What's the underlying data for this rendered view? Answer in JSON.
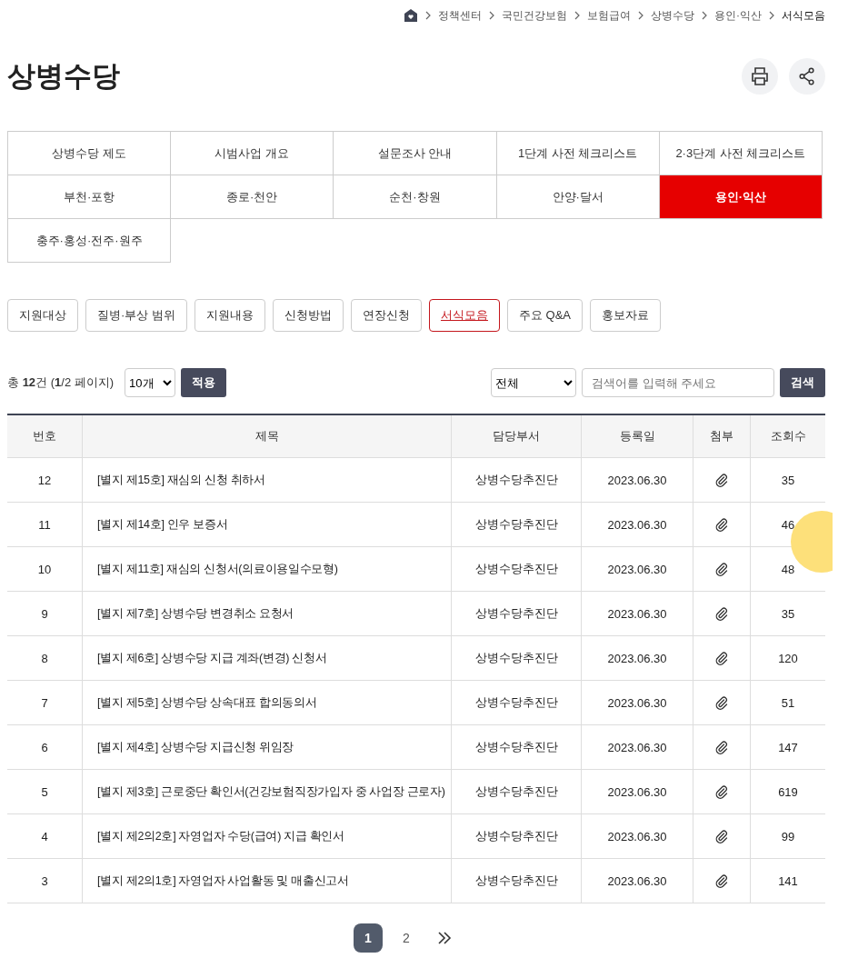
{
  "breadcrumb": [
    "정책센터",
    "국민건강보험",
    "보험급여",
    "상병수당",
    "용인·익산",
    "서식모음"
  ],
  "title": "상병수당",
  "region_tabs": [
    {
      "label": "상병수당 제도",
      "selected": false
    },
    {
      "label": "시범사업 개요",
      "selected": false
    },
    {
      "label": "설문조사 안내",
      "selected": false
    },
    {
      "label": "1단계 사전 체크리스트",
      "selected": false
    },
    {
      "label": "2·3단계 사전 체크리스트",
      "selected": false
    },
    {
      "label": "부천·포항",
      "selected": false
    },
    {
      "label": "종로·천안",
      "selected": false
    },
    {
      "label": "순천·창원",
      "selected": false
    },
    {
      "label": "안양·달서",
      "selected": false
    },
    {
      "label": "용인·익산",
      "selected": true
    },
    {
      "label": "충주·홍성·전주·원주",
      "selected": false
    }
  ],
  "sub_tabs": [
    {
      "label": "지원대상",
      "selected": false
    },
    {
      "label": "질병·부상 범위",
      "selected": false
    },
    {
      "label": "지원내용",
      "selected": false
    },
    {
      "label": "신청방법",
      "selected": false
    },
    {
      "label": "연장신청",
      "selected": false
    },
    {
      "label": "서식모음",
      "selected": true
    },
    {
      "label": "주요 Q&A",
      "selected": false
    },
    {
      "label": "홍보자료",
      "selected": false
    }
  ],
  "summary": "총 **12**건 (**1**/2 페이지)",
  "page_size": "10개",
  "apply_button": "적용",
  "search_scope": "전체",
  "search": {
    "placeholder": "검색어를 입력해 주세요"
  },
  "search_button": "검색",
  "table": {
    "columns": [
      "번호",
      "제목",
      "담당부서",
      "등록일",
      "첨부",
      "조회수"
    ],
    "rows": [
      {
        "no": "12",
        "title": "[별지 제15호] 재심의 신청 취하서",
        "dept": "상병수당추진단",
        "date": "2023.06.30",
        "views": "35"
      },
      {
        "no": "11",
        "title": "[별지 제14호] 인우 보증서",
        "dept": "상병수당추진단",
        "date": "2023.06.30",
        "views": "46"
      },
      {
        "no": "10",
        "title": "[별지 제11호] 재심의 신청서(의료이용일수모형)",
        "dept": "상병수당추진단",
        "date": "2023.06.30",
        "views": "48"
      },
      {
        "no": "9",
        "title": "[별지 제7호] 상병수당 변경취소 요청서",
        "dept": "상병수당추진단",
        "date": "2023.06.30",
        "views": "35"
      },
      {
        "no": "8",
        "title": "[별지 제6호] 상병수당 지급 계좌(변경) 신청서",
        "dept": "상병수당추진단",
        "date": "2023.06.30",
        "views": "120"
      },
      {
        "no": "7",
        "title": "[별지 제5호] 상병수당 상속대표 합의동의서",
        "dept": "상병수당추진단",
        "date": "2023.06.30",
        "views": "51"
      },
      {
        "no": "6",
        "title": "[별지 제4호] 상병수당 지급신청 위임장",
        "dept": "상병수당추진단",
        "date": "2023.06.30",
        "views": "147"
      },
      {
        "no": "5",
        "title": "[별지 제3호] 근로중단 확인서(건강보험직장가입자 중 사업장 근로자)",
        "dept": "상병수당추진단",
        "date": "2023.06.30",
        "views": "619"
      },
      {
        "no": "4",
        "title": "[별지 제2의2호] 자영업자 수당(급여) 지급 확인서",
        "dept": "상병수당추진단",
        "date": "2023.06.30",
        "views": "99"
      },
      {
        "no": "3",
        "title": "[별지 제2의1호] 자영업자 사업활동 및 매출신고서",
        "dept": "상병수당추진단",
        "date": "2023.06.30",
        "views": "141"
      }
    ]
  },
  "pages": [
    {
      "label": "1",
      "selected": true
    },
    {
      "label": "2",
      "selected": false
    }
  ]
}
